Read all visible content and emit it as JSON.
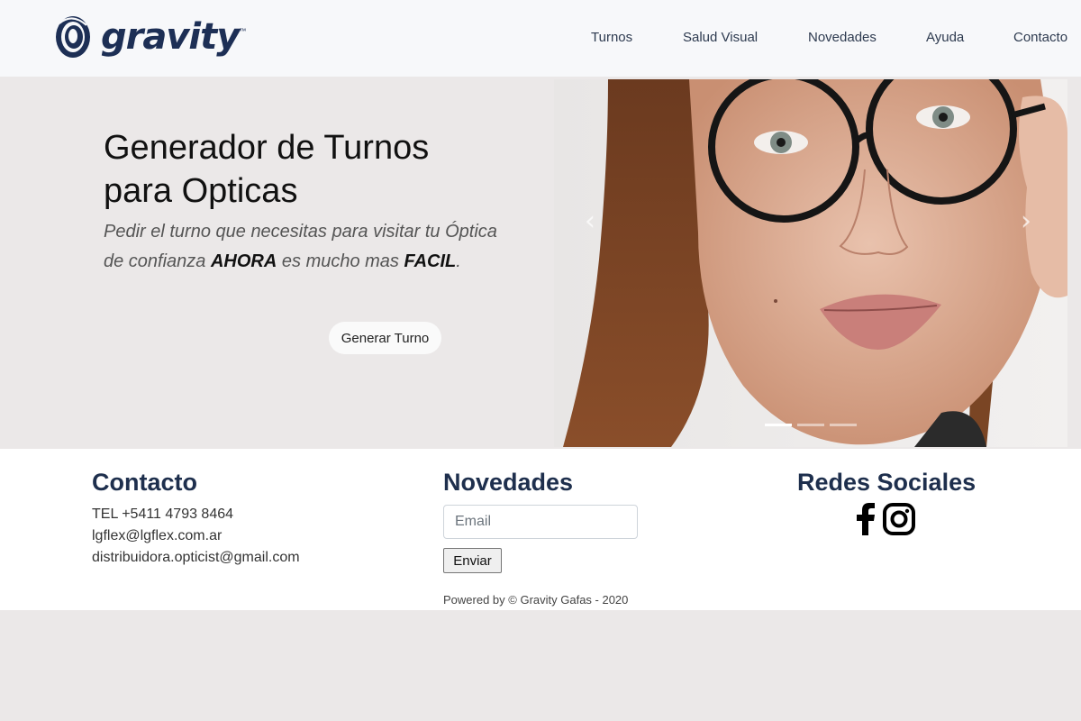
{
  "header": {
    "logo_text": "gravity",
    "logo_tm": "™",
    "nav": [
      {
        "label": "Turnos"
      },
      {
        "label": "Salud Visual"
      },
      {
        "label": "Novedades"
      },
      {
        "label": "Ayuda"
      },
      {
        "label": "Contacto"
      }
    ]
  },
  "hero": {
    "title": "Generador de Turnos para Opticas",
    "subtitle_parts": [
      "Pedir el turno que necesitas para visitar tu Óptica de confianza ",
      "AHORA",
      " es mucho mas ",
      "FACIL",
      "."
    ],
    "button_label": "Generar Turno",
    "carousel": {
      "prev_icon": "‹",
      "next_icon": "›",
      "slides_count": 3,
      "active_slide": 1
    }
  },
  "footer": {
    "contact": {
      "heading": "Contacto",
      "lines": [
        "TEL +5411 4793 8464",
        "lgflex@lgflex.com.ar",
        "distribuidora.opticist@gmail.com"
      ]
    },
    "news": {
      "heading": "Novedades",
      "email_placeholder": "Email",
      "send_label": "Enviar",
      "powered": "Powered by © Gravity Gafas - 2020"
    },
    "social": {
      "heading": "Redes Sociales",
      "icons": [
        "facebook-icon",
        "instagram-icon"
      ]
    }
  },
  "colors": {
    "navbar_bg": "#f7f8fa",
    "hero_bg": "#ebe8e8",
    "brand": "#1d2f55",
    "footer_heading": "#1e2f4d"
  }
}
